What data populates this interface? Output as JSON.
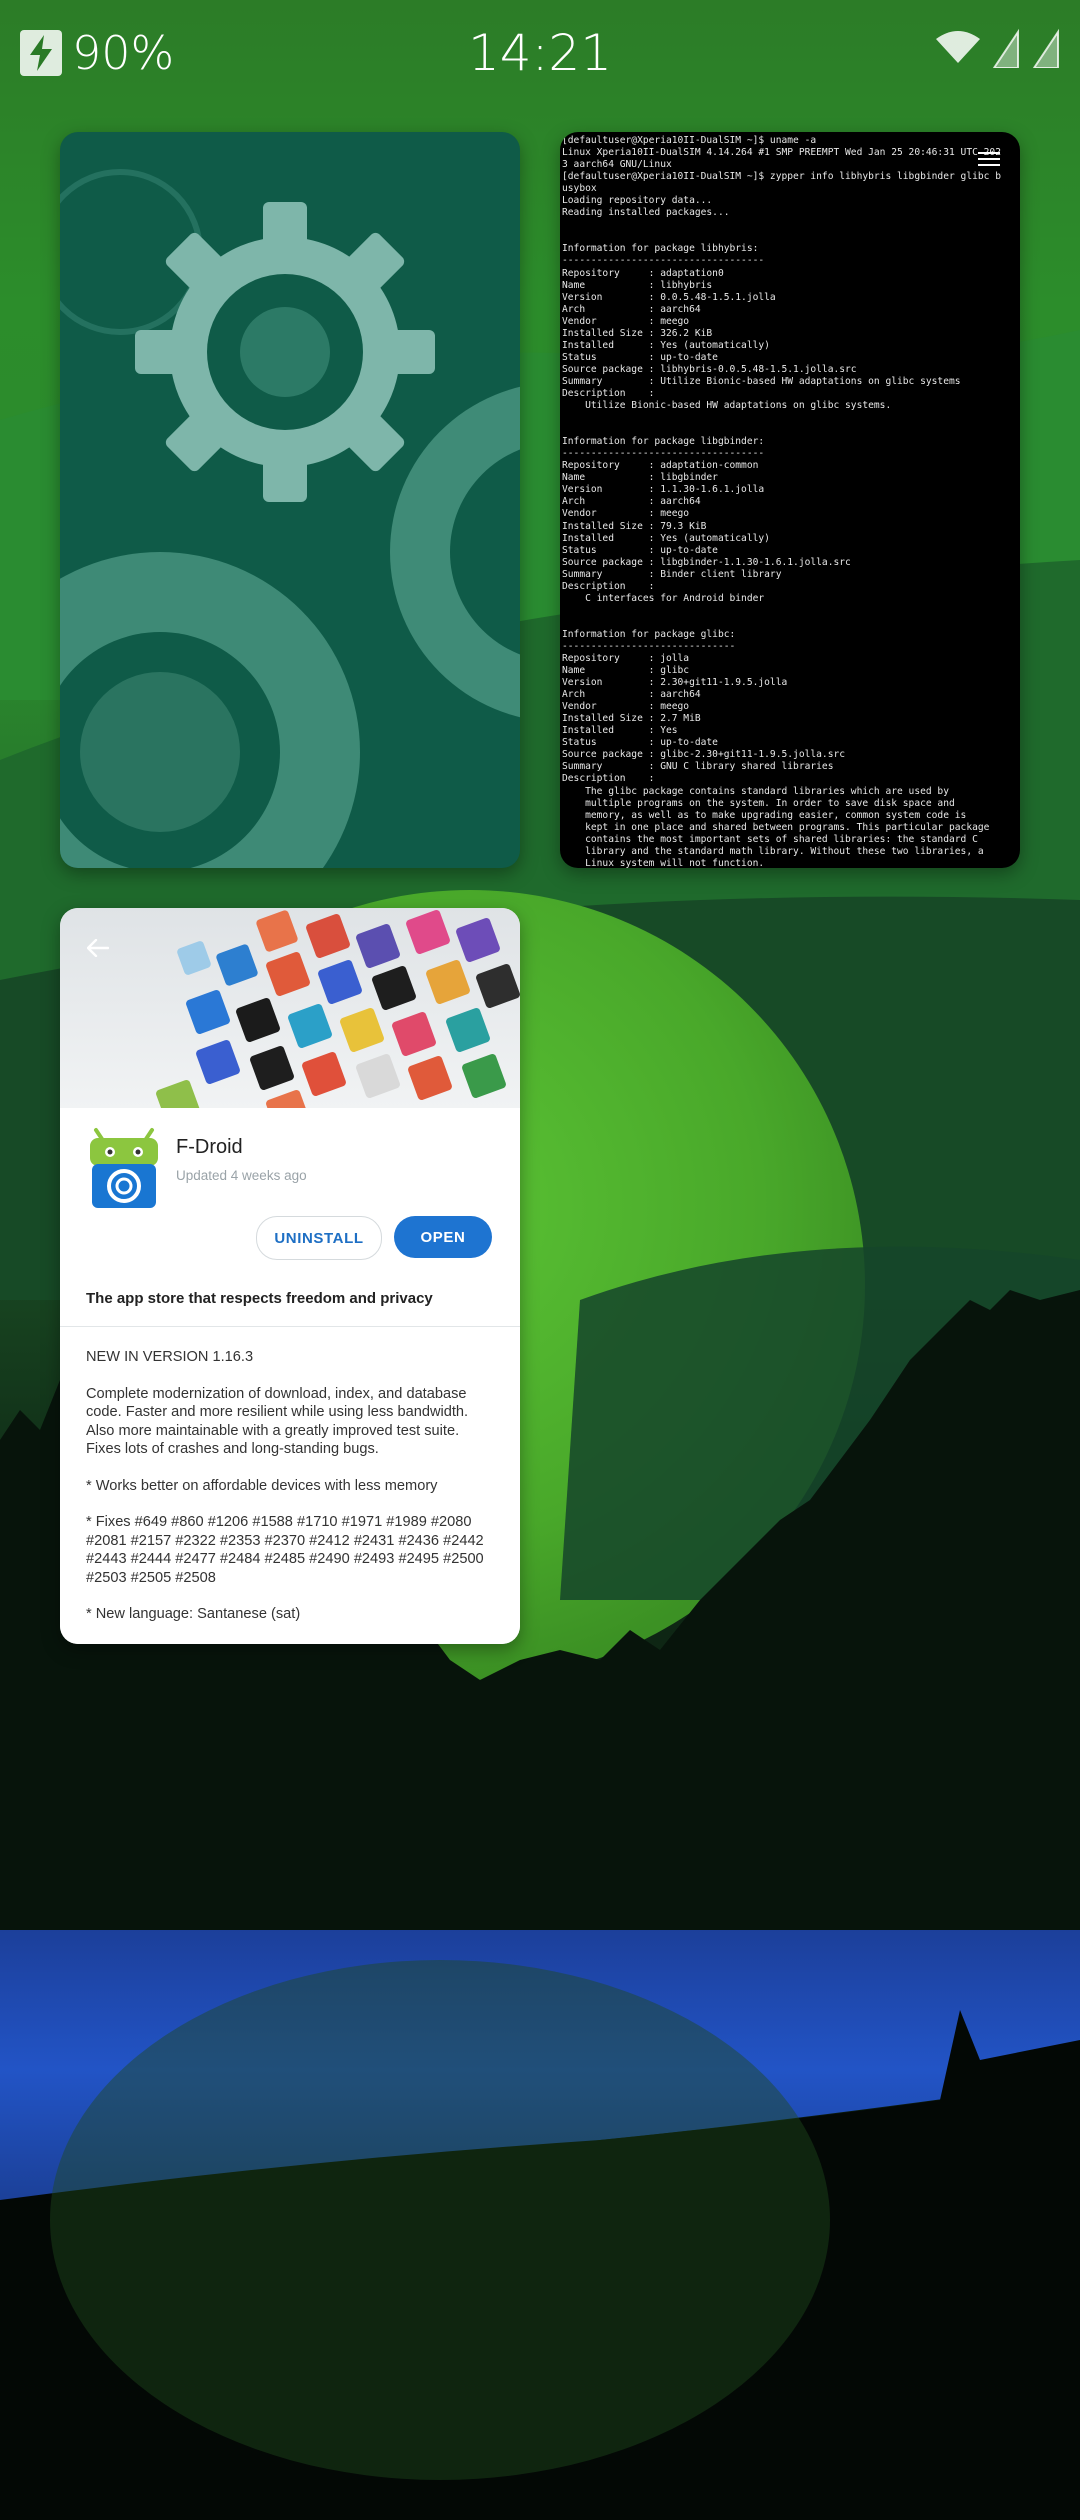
{
  "status_bar": {
    "battery_percent": "90%",
    "time": "14:21",
    "icons": [
      "charging-bolt-icon",
      "wifi-icon",
      "signal-sim1-icon",
      "signal-sim2-icon"
    ]
  },
  "cards": {
    "settings": {
      "icon": "gears-icon"
    },
    "terminal": {
      "lines": [
        "[defaultuser@Xperia10II-DualSIM ~]$ uname -a",
        "Linux Xperia10II-DualSIM 4.14.264 #1 SMP PREEMPT Wed Jan 25 20:46:31 UTC 202",
        "3 aarch64 GNU/Linux",
        "[defaultuser@Xperia10II-DualSIM ~]$ zypper info libhybris libgbinder glibc b",
        "usybox",
        "Loading repository data...",
        "Reading installed packages...",
        "",
        "",
        "Information for package libhybris:",
        "-----------------------------------",
        "Repository     : adaptation0",
        "Name           : libhybris",
        "Version        : 0.0.5.48-1.5.1.jolla",
        "Arch           : aarch64",
        "Vendor         : meego",
        "Installed Size : 326.2 KiB",
        "Installed      : Yes (automatically)",
        "Status         : up-to-date",
        "Source package : libhybris-0.0.5.48-1.5.1.jolla.src",
        "Summary        : Utilize Bionic-based HW adaptations on glibc systems",
        "Description    :",
        "    Utilize Bionic-based HW adaptations on glibc systems.",
        "",
        "",
        "Information for package libgbinder:",
        "-----------------------------------",
        "Repository     : adaptation-common",
        "Name           : libgbinder",
        "Version        : 1.1.30-1.6.1.jolla",
        "Arch           : aarch64",
        "Vendor         : meego",
        "Installed Size : 79.3 KiB",
        "Installed      : Yes (automatically)",
        "Status         : up-to-date",
        "Source package : libgbinder-1.1.30-1.6.1.jolla.src",
        "Summary        : Binder client library",
        "Description    :",
        "    C interfaces for Android binder",
        "",
        "",
        "Information for package glibc:",
        "------------------------------",
        "Repository     : jolla",
        "Name           : glibc",
        "Version        : 2.30+git11-1.9.5.jolla",
        "Arch           : aarch64",
        "Vendor         : meego",
        "Installed Size : 2.7 MiB",
        "Installed      : Yes",
        "Status         : up-to-date",
        "Source package : glibc-2.30+git11-1.9.5.jolla.src",
        "Summary        : GNU C library shared libraries",
        "Description    :",
        "    The glibc package contains standard libraries which are used by",
        "    multiple programs on the system. In order to save disk space and",
        "    memory, as well as to make upgrading easier, common system code is",
        "    kept in one place and shared between programs. This particular package",
        "    contains the most important sets of shared libraries: the standard C",
        "    library and the standard math library. Without these two libraries, a",
        "    Linux system will not function."
      ]
    },
    "fdroid": {
      "app_name": "F-Droid",
      "updated": "Updated 4 weeks ago",
      "uninstall_label": "UNINSTALL",
      "open_label": "OPEN",
      "tagline": "The app store that respects freedom and privacy",
      "version_heading": "NEW IN VERSION 1.16.3",
      "paragraphs": [
        "Complete modernization of download, index, and database code. Faster and more resilient while using less bandwidth. Also more maintainable with a greatly improved test suite. Fixes lots of crashes and long-standing bugs.",
        "* Works better on affordable devices with less memory",
        "* Fixes #649 #860 #1206 #1588 #1710 #1971 #1989 #2080 #2081 #2157 #2322 #2353 #2370 #2412 #2431 #2436 #2442 #2443 #2444 #2477 #2484 #2485 #2490 #2493 #2495 #2500 #2503 #2505 #2508",
        "* New language: Santanese (sat)"
      ],
      "colors": {
        "accent": "#1e74d1",
        "android_green": "#8cc63f"
      }
    }
  },
  "colors": {
    "sky_green": "#2a8a2a",
    "moon_green": "#4fb02e",
    "settings_card": "#0f5b48",
    "water_blue": "#1f4fbf"
  }
}
